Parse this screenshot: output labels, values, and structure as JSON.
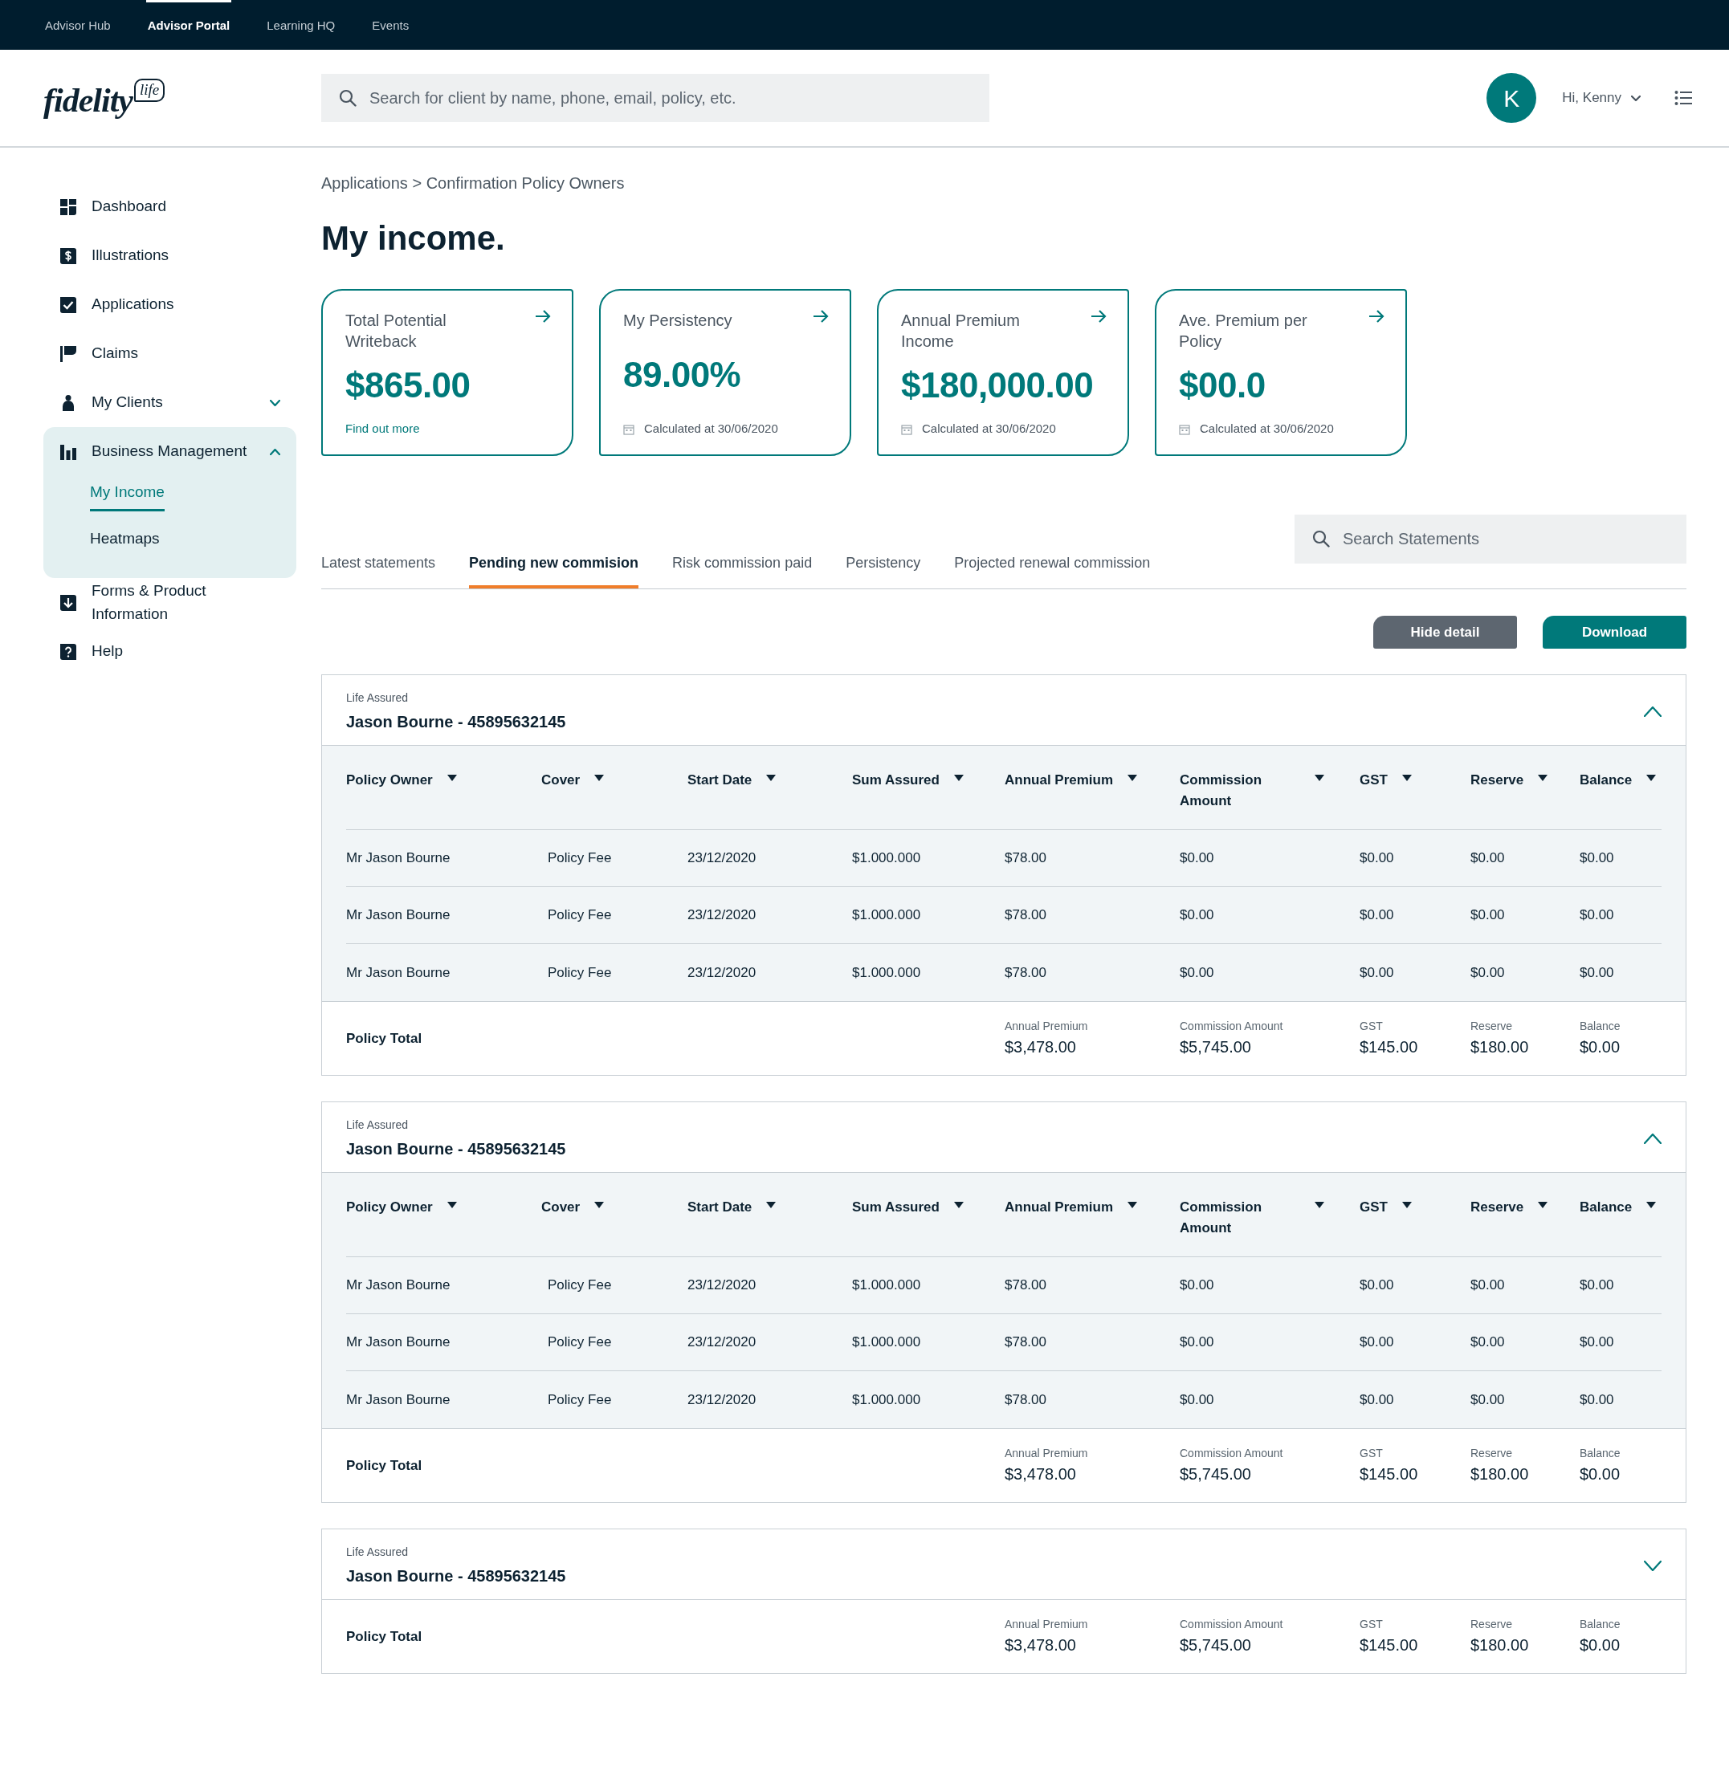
{
  "top_nav": [
    {
      "label": "Advisor Hub",
      "selected": false
    },
    {
      "label": "Advisor Portal",
      "selected": true
    },
    {
      "label": "Learning HQ",
      "selected": false
    },
    {
      "label": "Events",
      "selected": false
    }
  ],
  "logo": {
    "text": "fidelity",
    "badge": "life"
  },
  "search": {
    "placeholder": "Search for client by name, phone, email, policy, etc."
  },
  "user": {
    "initial": "K",
    "greeting": "Hi, Kenny"
  },
  "sidebar": {
    "items": [
      {
        "label": "Dashboard",
        "kind": "link"
      },
      {
        "label": "Illustrations",
        "kind": "link"
      },
      {
        "label": "Applications",
        "kind": "link"
      },
      {
        "label": "Claims",
        "kind": "link"
      },
      {
        "label": "My Clients",
        "kind": "group",
        "expanded": false
      },
      {
        "label": "Business Management",
        "kind": "group",
        "expanded": true,
        "children": [
          {
            "label": "My Income",
            "selected": true
          },
          {
            "label": "Heatmaps",
            "selected": false
          }
        ]
      },
      {
        "label": "Forms & Product Information",
        "kind": "link"
      },
      {
        "label": "Help",
        "kind": "link"
      }
    ]
  },
  "breadcrumb": "Applications > Confirmation Policy Owners",
  "title": "My income.",
  "cards": [
    {
      "title": "Total Potential Writeback",
      "value": "$865.00",
      "kind": "link",
      "footer": "Find out more"
    },
    {
      "title": "My Persistency",
      "value": "89.00%",
      "kind": "date",
      "footer": "Calculated at 30/06/2020"
    },
    {
      "title": "Annual Premium Income",
      "value": "$180,000.00",
      "kind": "date",
      "footer": "Calculated at 30/06/2020"
    },
    {
      "title": "Ave. Premium per Policy",
      "value": "$00.0",
      "kind": "date",
      "footer": "Calculated at 30/06/2020"
    }
  ],
  "tabs": [
    {
      "label": "Latest statements",
      "selected": false
    },
    {
      "label": "Pending new commision",
      "selected": true
    },
    {
      "label": "Risk commission paid",
      "selected": false
    },
    {
      "label": "Persistency",
      "selected": false
    },
    {
      "label": "Projected renewal commission",
      "selected": false
    }
  ],
  "statement_search": {
    "placeholder": "Search Statements"
  },
  "buttons": [
    "Hide detail",
    "Download"
  ],
  "policies": [
    {
      "label": "Life Assured",
      "name": "Jason Bourne - 45895632145",
      "expanded": true,
      "columns": [
        "Policy Owner",
        "Cover",
        "Start Date",
        "Sum Assured",
        "Annual Premium",
        "Commission Amount",
        "GST",
        "Reserve",
        "Balance"
      ],
      "rows": [
        [
          "Mr Jason Bourne",
          "Policy Fee",
          "23/12/2020",
          "$1.000.000",
          "$78.00",
          "$0.00",
          "$0.00",
          "$0.00",
          "$0.00"
        ],
        [
          "Mr Jason Bourne",
          "Policy Fee",
          "23/12/2020",
          "$1.000.000",
          "$78.00",
          "$0.00",
          "$0.00",
          "$0.00",
          "$0.00"
        ],
        [
          "Mr Jason Bourne",
          "Policy Fee",
          "23/12/2020",
          "$1.000.000",
          "$78.00",
          "$0.00",
          "$0.00",
          "$0.00",
          "$0.00"
        ]
      ],
      "total": {
        "label": "Policy Total",
        "items": [
          {
            "label": "Annual Premium",
            "value": "$3,478.00"
          },
          {
            "label": "Commission Amount",
            "value": "$5,745.00"
          },
          {
            "label": "GST",
            "value": "$145.00"
          },
          {
            "label": "Reserve",
            "value": "$180.00"
          },
          {
            "label": "Balance",
            "value": "$0.00"
          }
        ]
      }
    },
    {
      "label": "Life Assured",
      "name": "Jason Bourne - 45895632145",
      "expanded": true,
      "columns": [
        "Policy Owner",
        "Cover",
        "Start Date",
        "Sum Assured",
        "Annual Premium",
        "Commission Amount",
        "GST",
        "Reserve",
        "Balance"
      ],
      "rows": [
        [
          "Mr Jason Bourne",
          "Policy Fee",
          "23/12/2020",
          "$1.000.000",
          "$78.00",
          "$0.00",
          "$0.00",
          "$0.00",
          "$0.00"
        ],
        [
          "Mr Jason Bourne",
          "Policy Fee",
          "23/12/2020",
          "$1.000.000",
          "$78.00",
          "$0.00",
          "$0.00",
          "$0.00",
          "$0.00"
        ],
        [
          "Mr Jason Bourne",
          "Policy Fee",
          "23/12/2020",
          "$1.000.000",
          "$78.00",
          "$0.00",
          "$0.00",
          "$0.00",
          "$0.00"
        ]
      ],
      "total": {
        "label": "Policy Total",
        "items": [
          {
            "label": "Annual Premium",
            "value": "$3,478.00"
          },
          {
            "label": "Commission Amount",
            "value": "$5,745.00"
          },
          {
            "label": "GST",
            "value": "$145.00"
          },
          {
            "label": "Reserve",
            "value": "$180.00"
          },
          {
            "label": "Balance",
            "value": "$0.00"
          }
        ]
      }
    },
    {
      "label": "Life Assured",
      "name": "Jason Bourne - 45895632145",
      "expanded": false,
      "total": {
        "label": "Policy Total",
        "items": [
          {
            "label": "Annual Premium",
            "value": "$3,478.00"
          },
          {
            "label": "Commission Amount",
            "value": "$5,745.00"
          },
          {
            "label": "GST",
            "value": "$145.00"
          },
          {
            "label": "Reserve",
            "value": "$180.00"
          },
          {
            "label": "Balance",
            "value": "$0.00"
          }
        ]
      }
    }
  ]
}
